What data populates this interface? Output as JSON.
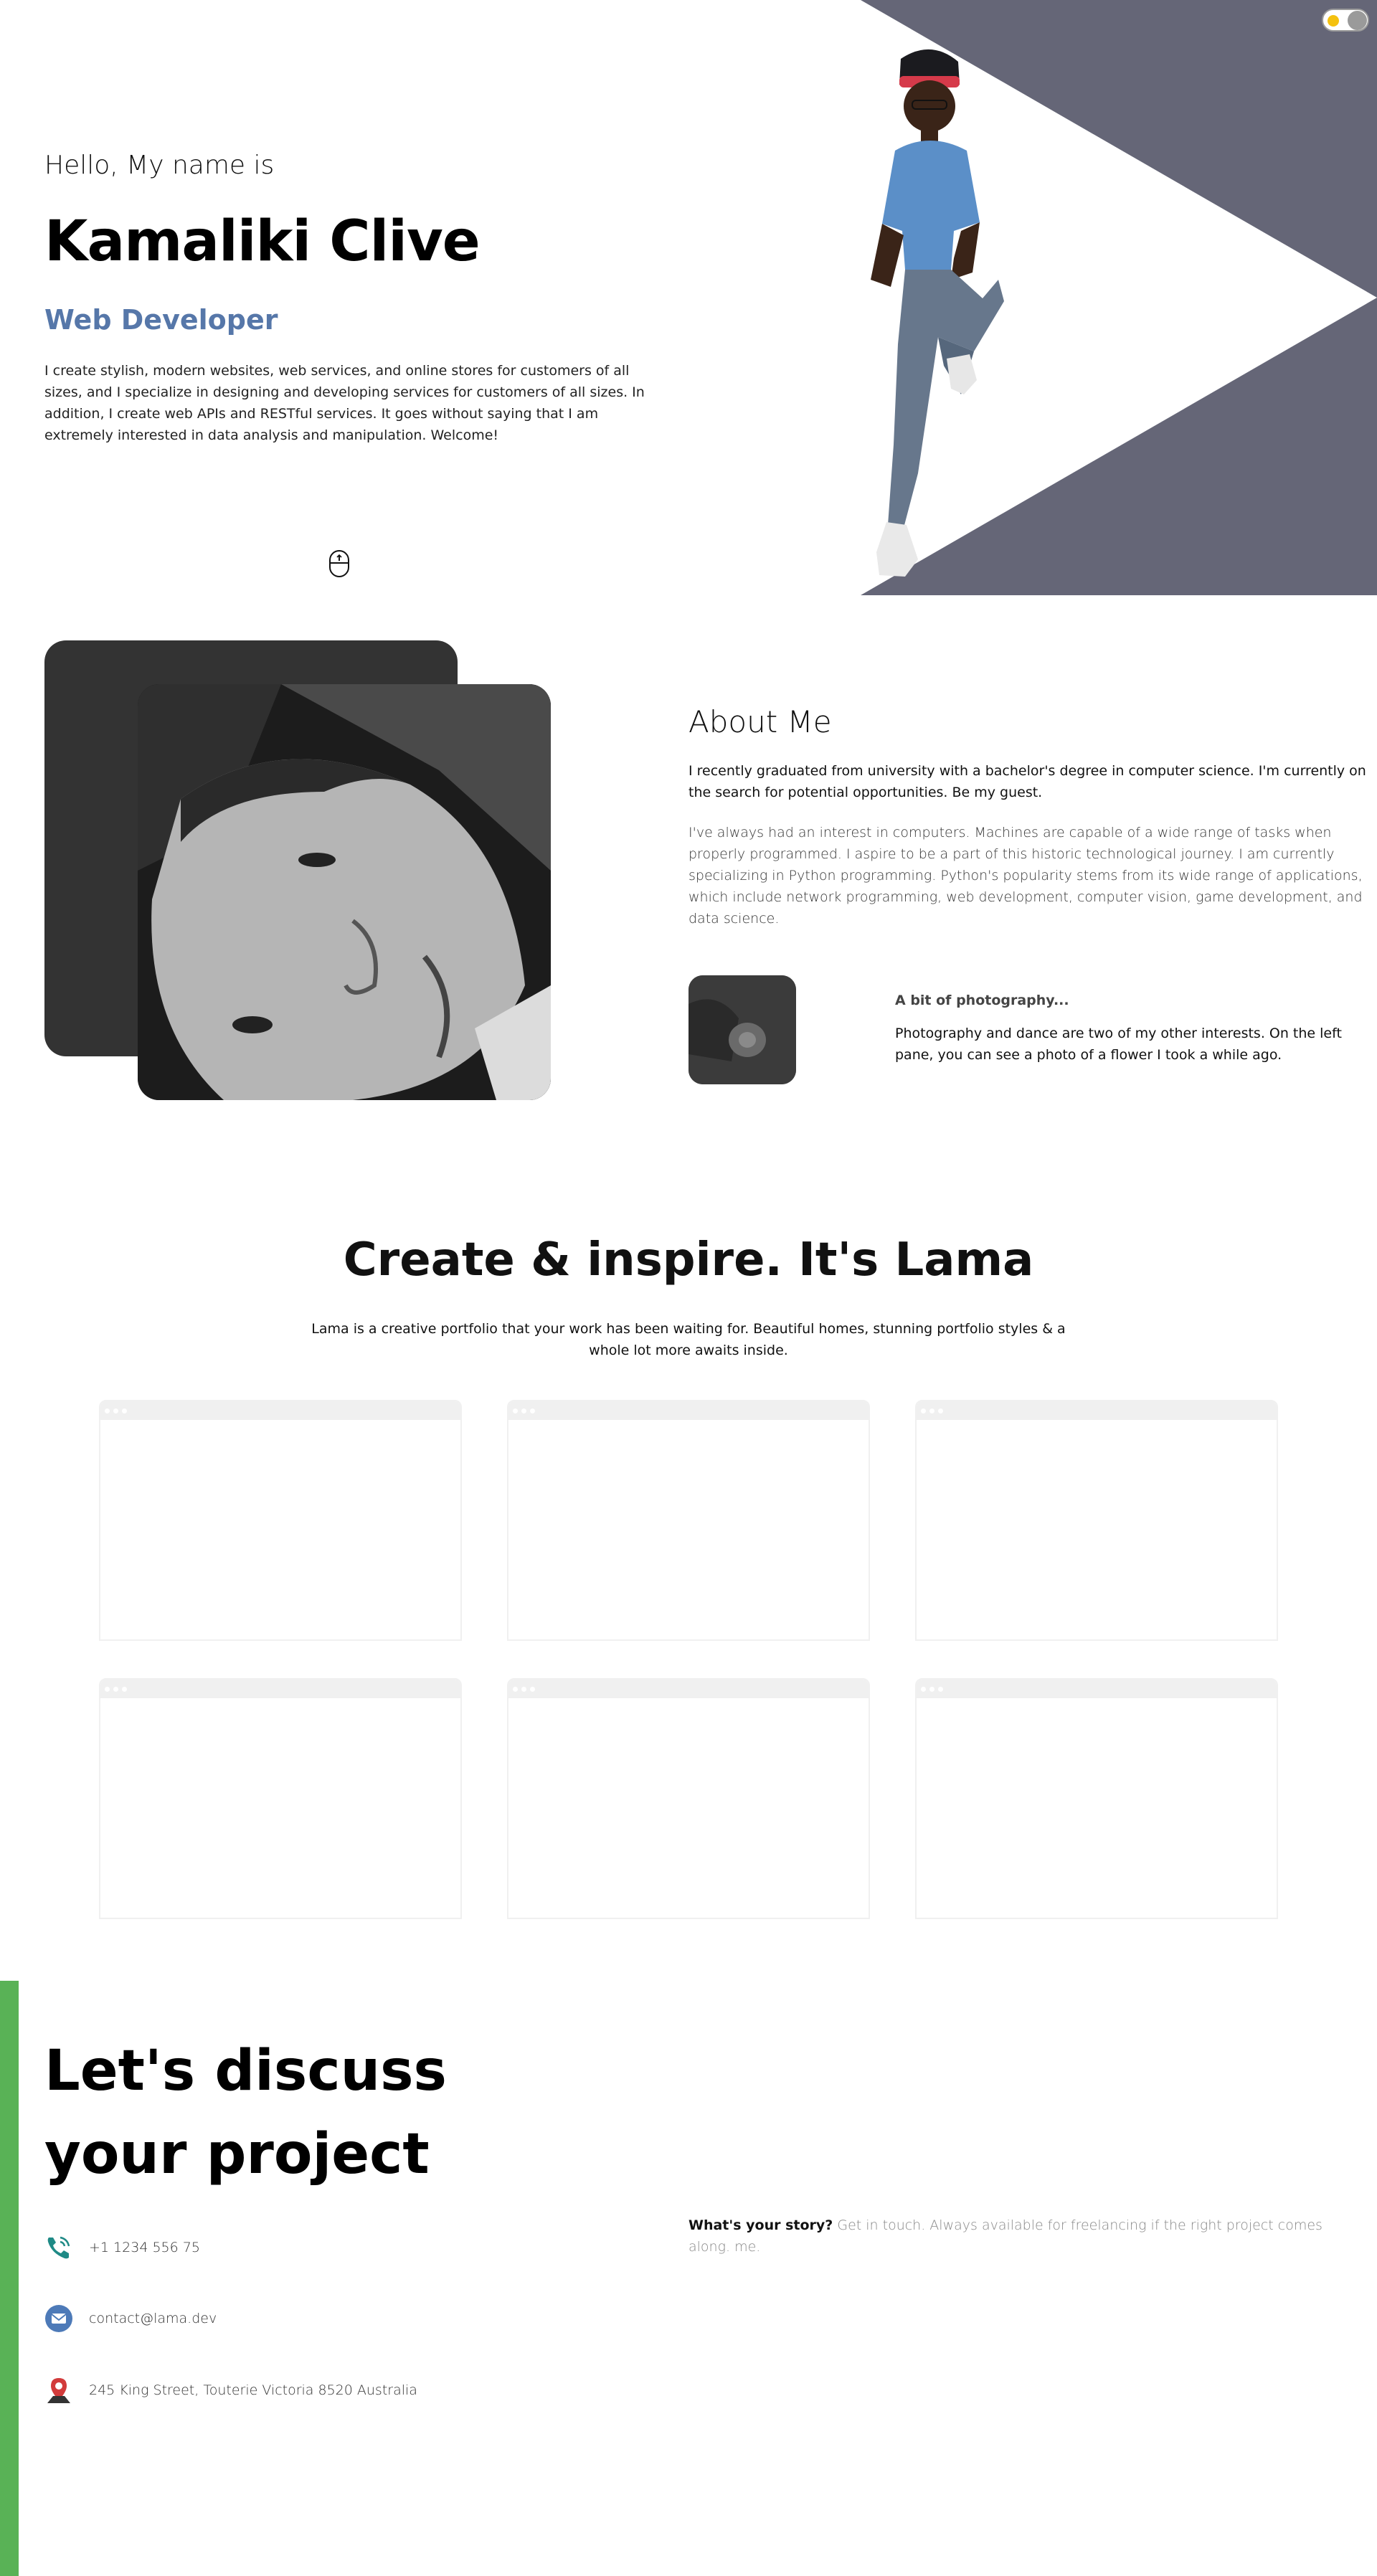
{
  "theme": {
    "accent": "#5677a9",
    "hero_bg": "#656677",
    "contact_bar": "#59b256",
    "toggle_sun": "#f4c10f"
  },
  "toggle": {
    "state": "light"
  },
  "intro": {
    "hello": "Hello, My name is",
    "name": "Kamaliki Clive",
    "title": "Web Developer",
    "description": "I create stylish, modern websites, web services, and online stores for customers of all sizes, and I specialize in designing and developing services for customers of all sizes. In addition, I create web APIs and RESTful services. It goes without saying that I am extremely interested in data analysis and manipulation. Welcome!",
    "scroll_icon": "mouse-scroll-icon"
  },
  "about": {
    "title": "About Me",
    "sub": "I recently graduated from university with a bachelor's degree in computer science. I'm currently on the search for potential opportunities. Be my guest.",
    "desc": "I've always had an interest in computers. Machines are capable of a wide range of tasks when properly programmed. I aspire to be a part of this historic technological journey. I am currently specializing in Python programming. Python's popularity stems from its wide range of applications, which include network programming, web development, computer vision, game development, and data science.",
    "award_title": "A bit of photography...",
    "award_desc": "Photography and dance are two of my other interests. On the left pane, you can see a photo of a flower I took a while ago."
  },
  "products": {
    "title": "Create & inspire. It's Lama",
    "desc": "Lama is a creative portfolio that your work has been waiting for. Beautiful homes, stunning portfolio styles & a whole lot more awaits inside.",
    "count": 6
  },
  "contact": {
    "title": "Let's discuss your project",
    "phone": "+1 1234 556 75",
    "email": "contact@lama.dev",
    "address": "245 King Street, Touterie Victoria 8520 Australia",
    "desc_bold": "What's your story?",
    "desc": " Get in touch. Always available for freelancing if the right project comes along. me."
  }
}
